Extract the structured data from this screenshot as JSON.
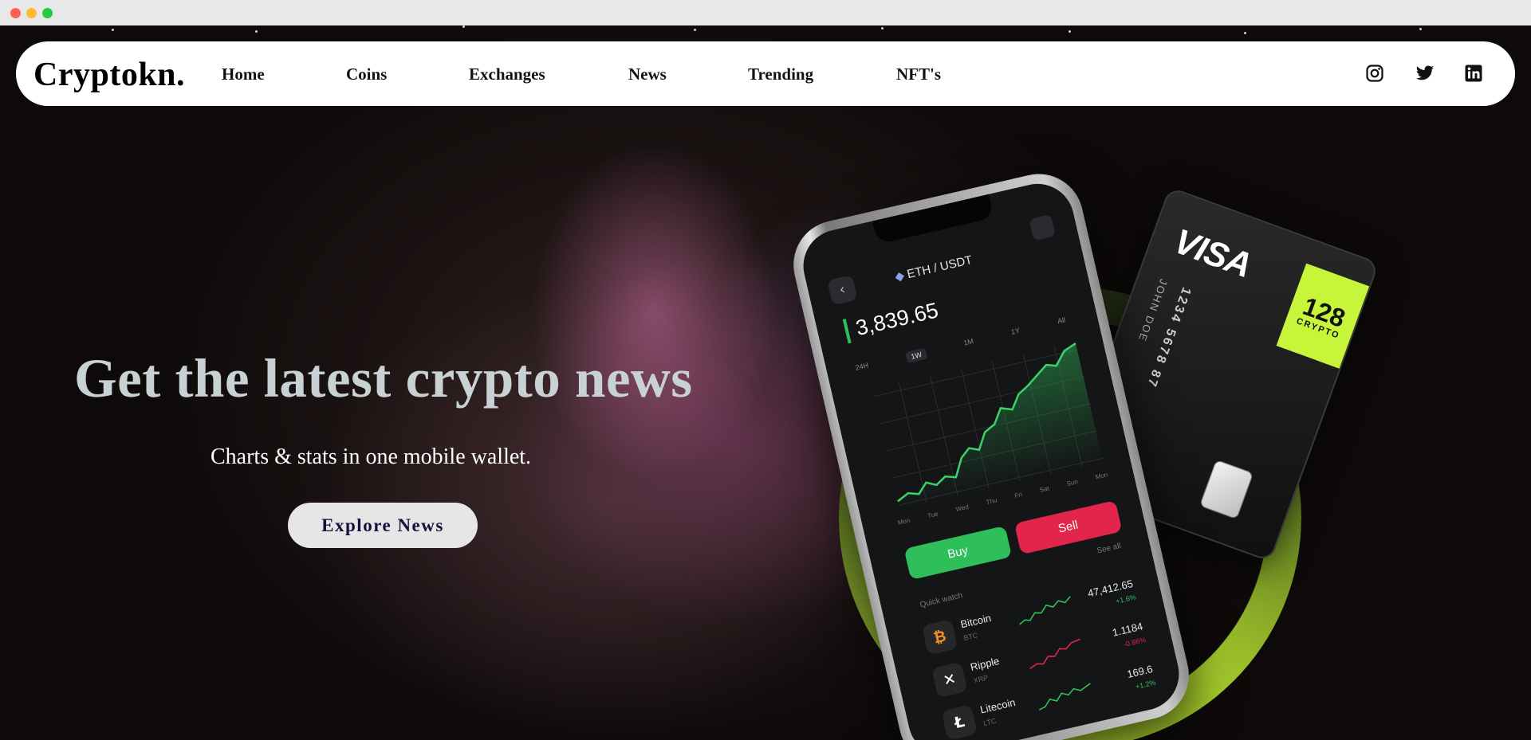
{
  "brand": {
    "logo": "Cryptokn."
  },
  "nav": {
    "links": [
      "Home",
      "Coins",
      "Exchanges",
      "News",
      "Trending",
      "NFT's"
    ],
    "social": [
      "instagram-icon",
      "twitter-icon",
      "linkedin-icon"
    ]
  },
  "hero": {
    "headline": "Get the latest crypto news",
    "subline": "Charts & stats in one mobile wallet.",
    "cta_label": "Explore News"
  },
  "card": {
    "brand": "VISA",
    "tag_number": "128",
    "tag_sub": "CRYPTO",
    "number": "1234 5678 87",
    "holder": "JOHN DOE"
  },
  "phone": {
    "pair": "ETH / USDT",
    "price": "3,839.65",
    "tabs": [
      "24H",
      "1W",
      "1M",
      "1Y",
      "All"
    ],
    "active_tab": "1W",
    "days": [
      "Mon",
      "Tue",
      "Wed",
      "Thu",
      "Fri",
      "Sat",
      "Sun",
      "Mon"
    ],
    "buy_label": "Buy",
    "sell_label": "Sell",
    "quick_watch_label": "Quick watch",
    "see_all_label": "See all",
    "coins": [
      {
        "name": "Bitcoin",
        "symbol": "BTC",
        "value": "47,412.65",
        "change": "+1.6%",
        "trend": "up"
      },
      {
        "name": "Ripple",
        "symbol": "XRP",
        "value": "1.1184",
        "change": "-0.86%",
        "trend": "down"
      },
      {
        "name": "Litecoin",
        "symbol": "LTC",
        "value": "169.6",
        "change": "+1.2%",
        "trend": "up"
      }
    ]
  },
  "colors": {
    "accent_green": "#c6f53a",
    "buy": "#2fbf5a",
    "sell": "#e2254a",
    "cta_text": "#1b0f3a",
    "headline": "#c8d2d4"
  }
}
